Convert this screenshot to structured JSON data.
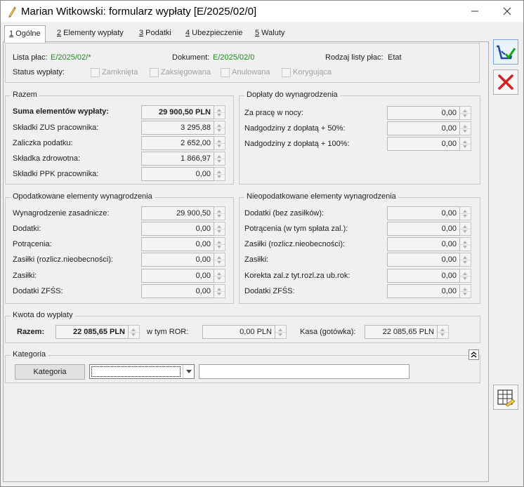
{
  "window": {
    "title": "Marian Witkowski: formularz wypłaty [E/2025/02/0]"
  },
  "tabs": [
    {
      "num": "1",
      "label": " Ogólne"
    },
    {
      "num": "2",
      "label": " Elementy wypłaty"
    },
    {
      "num": "3",
      "label": " Podatki"
    },
    {
      "num": "4",
      "label": " Ubezpieczenie"
    },
    {
      "num": "5",
      "label": " Waluty"
    }
  ],
  "header": {
    "lista_label": "Lista płac:",
    "lista_value": "E/2025/02/*",
    "dokument_label": "Dokument:",
    "dokument_value": "E/2025/02/0",
    "rodzaj_label": "Rodzaj listy płac:",
    "rodzaj_value": "Etat",
    "status_label": "Status wypłaty:",
    "statuses": [
      "Zamknięta",
      "Zaksięgowana",
      "Anulowana",
      "Korygująca"
    ]
  },
  "razem": {
    "title": "Razem",
    "rows": [
      {
        "label": "Suma elementów wypłaty:",
        "value": "29 900,50 PLN"
      },
      {
        "label": "Składki ZUS pracownika:",
        "value": "3 295,88"
      },
      {
        "label": "Zaliczka podatku:",
        "value": "2 652,00"
      },
      {
        "label": "Składka zdrowotna:",
        "value": "1 866,97"
      },
      {
        "label": "Składki PPK pracownika:",
        "value": "0,00"
      }
    ]
  },
  "doplaty": {
    "title": "Dopłaty do wynagrodzenia",
    "rows": [
      {
        "label": "Za pracę w nocy:",
        "value": "0,00"
      },
      {
        "label": "Nadgodziny z dopłatą + 50%:",
        "value": "0,00"
      },
      {
        "label": "Nadgodziny z dopłatą + 100%:",
        "value": "0,00"
      }
    ]
  },
  "opodatkowane": {
    "title": "Opodatkowane elementy wynagrodzenia",
    "rows": [
      {
        "label": "Wynagrodzenie zasadnicze:",
        "value": "29 900,50"
      },
      {
        "label": "Dodatki:",
        "value": "0,00"
      },
      {
        "label": "Potrącenia:",
        "value": "0,00"
      },
      {
        "label": "Zasiłki (rozlicz.nieobecności):",
        "value": "0,00"
      },
      {
        "label": "Zasiłki:",
        "value": "0,00"
      },
      {
        "label": "Dodatki ZFŚS:",
        "value": "0,00"
      }
    ]
  },
  "nieopodatkowane": {
    "title": "Nieopodatkowane elementy wynagrodzenia",
    "rows": [
      {
        "label": "Dodatki (bez zasiłków):",
        "value": "0,00"
      },
      {
        "label": "Potrącenia (w tym spłata zal.):",
        "value": "0,00"
      },
      {
        "label": "Zasiłki (rozlicz.nieobecności):",
        "value": "0,00"
      },
      {
        "label": "Zasiłki:",
        "value": "0,00"
      },
      {
        "label": "Korekta zal.z tyt.rozl.za ub.rok:",
        "value": "0,00"
      },
      {
        "label": "Dodatki ZFŚS:",
        "value": "0,00"
      }
    ]
  },
  "kwota": {
    "title": "Kwota do wypłaty",
    "razem_label": "Razem:",
    "razem_value": "22 085,65 PLN",
    "ror_label": "w tym ROR:",
    "ror_value": "0,00 PLN",
    "kasa_label": "Kasa (gotówka):",
    "kasa_value": "22 085,65 PLN"
  },
  "kategoria": {
    "title": "Kategoria",
    "button_label": "Kategoria",
    "select_value": "",
    "description_value": ""
  },
  "icons": {
    "save": "save-check-icon",
    "cancel": "cancel-x-icon",
    "table": "table-edit-icon"
  }
}
